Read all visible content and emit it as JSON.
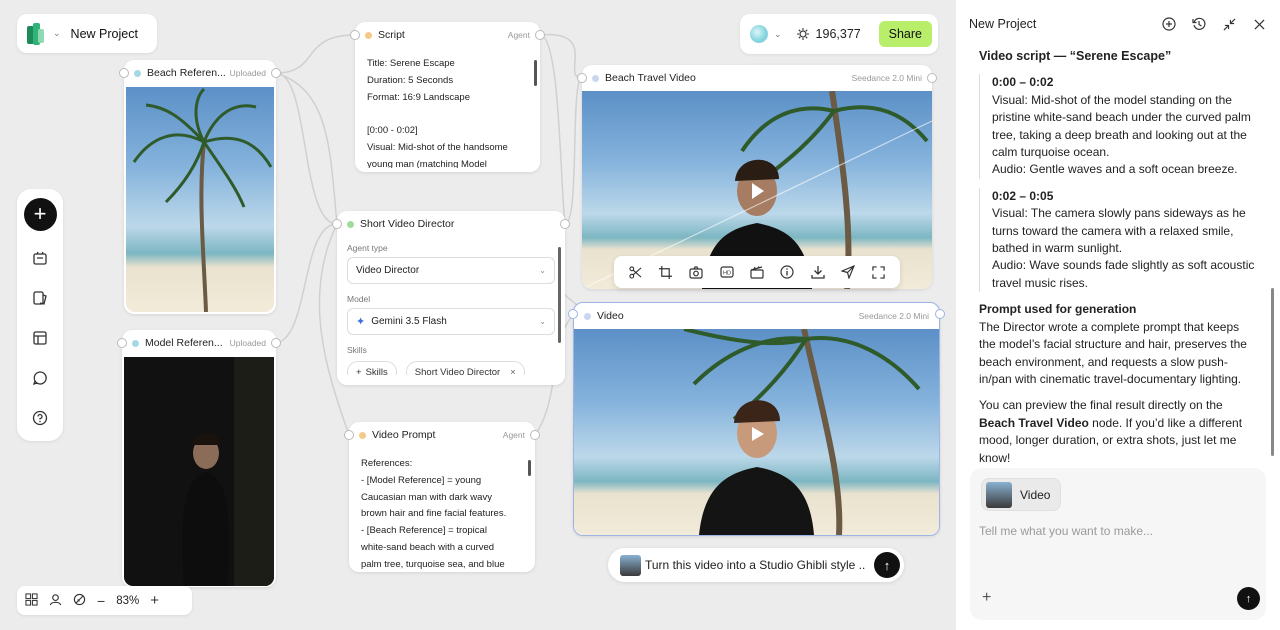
{
  "project": {
    "name": "New Project"
  },
  "topbar": {
    "credits": "196,377",
    "share_label": "Share"
  },
  "nodes": {
    "beach_ref": {
      "title": "Beach Referen...",
      "tag": "Uploaded"
    },
    "model_ref": {
      "title": "Model Referen...",
      "tag": "Uploaded"
    },
    "script": {
      "title": "Script",
      "tag": "Agent",
      "body": "Title: Serene Escape\nDuration: 5 Seconds\nFormat: 16:9 Landscape\n\n[0:00 - 0:02]\nVisual: Mid-shot of the handsome\nyoung man (matching Model"
    },
    "director": {
      "title": "Short Video Director",
      "agent_type_label": "Agent type",
      "agent_type_value": "Video Director",
      "model_label": "Model",
      "model_value": "Gemini 3.5 Flash",
      "skills_label": "Skills",
      "skills_add": "Skills",
      "skill_chip": "Short Video Director"
    },
    "video_prompt": {
      "title": "Video Prompt",
      "tag": "Agent",
      "body": "References:\n- [Model Reference] = young\nCaucasian man with dark wavy\nbrown hair and fine facial features.\n- [Beach Reference] = tropical\nwhite-sand beach with a curved\npalm tree, turquoise sea, and blue"
    },
    "beach_video": {
      "title": "Beach Travel Video",
      "tag": "Seedance 2.0 Mini"
    },
    "video": {
      "title": "Video",
      "tag": "Seedance 2.0 Mini"
    }
  },
  "float_tools": [
    "scissors-icon",
    "crop-icon",
    "camera-icon",
    "hd-icon",
    "clapper-icon",
    "info-icon",
    "download-icon",
    "send-icon",
    "fullscreen-icon"
  ],
  "prompt_bar": {
    "text": "Turn this video into a Studio Ghibli style ..."
  },
  "zoom": {
    "level": "83%"
  },
  "panel": {
    "title": "New Project",
    "heading": "Video script — “Serene Escape”",
    "sec1_time": "0:00 – 0:02",
    "sec1_visual": "Visual: Mid-shot of the model standing on the pristine white-sand beach under the curved palm tree, taking a deep breath and looking out at the calm turquoise ocean.",
    "sec1_audio": "Audio: Gentle waves and a soft ocean breeze.",
    "sec2_time": "0:02 – 0:05",
    "sec2_visual": "Visual: The camera slowly pans sideways as he turns toward the camera with a relaxed smile, bathed in warm sunlight.",
    "sec2_audio": "Audio: Wave sounds fade slightly as soft acoustic travel music rises.",
    "prompt_heading": "Prompt used for generation",
    "prompt_text": "The Director wrote a complete prompt that keeps the model’s facial structure and hair, preserves the beach environment, and requests a slow push-in/pan with cinematic travel-documentary lighting.",
    "final_pre": "You can preview the final result directly on the ",
    "final_bold": "Beach Travel Video",
    "final_post": " node. If you’d like a different mood, longer duration, or extra shots, just let me know!",
    "composer_chip": "Video",
    "composer_placeholder": "Tell me what you want to make..."
  }
}
